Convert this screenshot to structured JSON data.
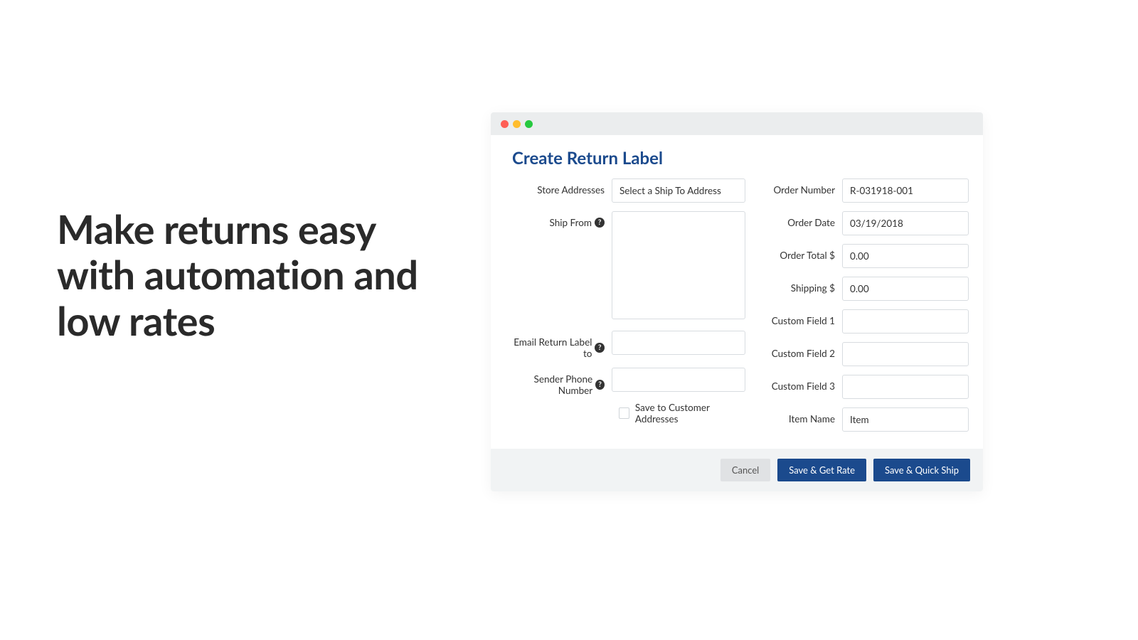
{
  "hero": {
    "text": "Make returns easy with automation and low rates"
  },
  "form": {
    "title": "Create Return Label",
    "left": {
      "store_addresses_label": "Store Addresses",
      "store_addresses_placeholder": "Select a Ship To Address",
      "ship_from_label": "Ship From",
      "ship_from_value": "",
      "email_label": "Email Return Label to",
      "email_value": "",
      "phone_label": "Sender Phone Number",
      "phone_value": "",
      "save_checkbox_label": "Save to Customer Addresses"
    },
    "right": {
      "order_number_label": "Order Number",
      "order_number_value": "R-031918-001",
      "order_date_label": "Order Date",
      "order_date_value": "03/19/2018",
      "order_total_label": "Order Total $",
      "order_total_value": "0.00",
      "shipping_label": "Shipping $",
      "shipping_value": "0.00",
      "custom1_label": "Custom Field 1",
      "custom1_value": "",
      "custom2_label": "Custom Field 2",
      "custom2_value": "",
      "custom3_label": "Custom Field 3",
      "custom3_value": "",
      "item_name_label": "Item Name",
      "item_name_value": "Item"
    },
    "actions": {
      "cancel": "Cancel",
      "save_rate": "Save & Get Rate",
      "save_ship": "Save & Quick Ship"
    }
  }
}
